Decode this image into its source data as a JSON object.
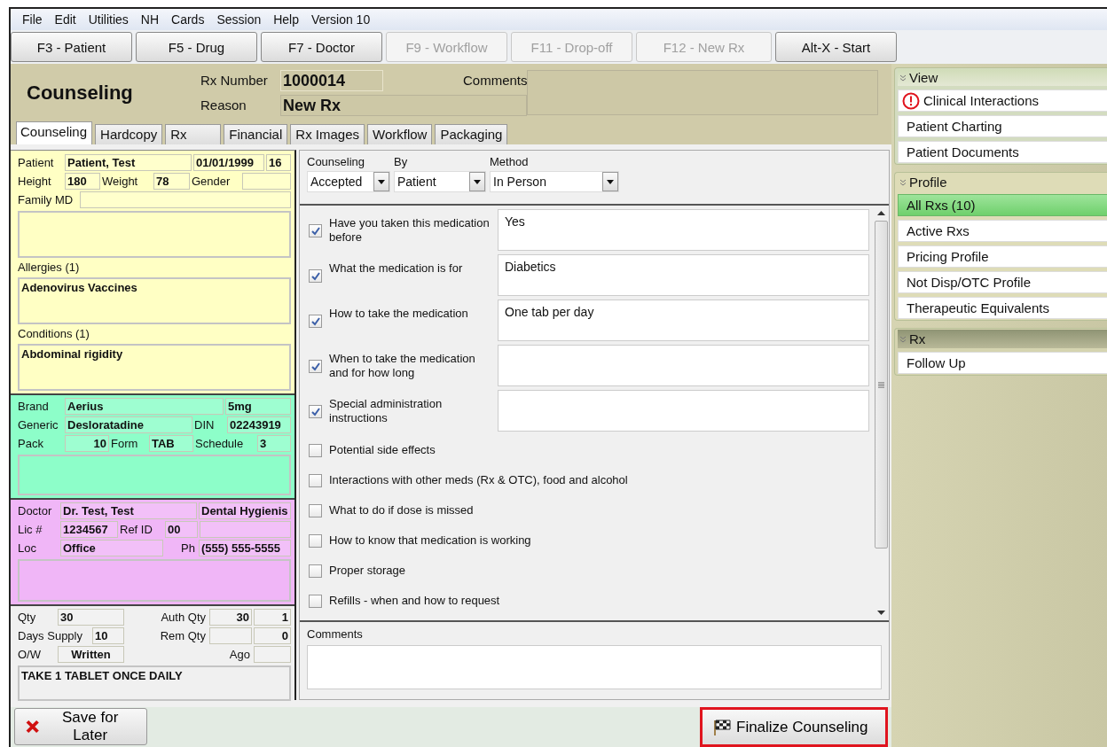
{
  "menu": [
    "File",
    "Edit",
    "Utilities",
    "NH",
    "Cards",
    "Session",
    "Help",
    "Version 10"
  ],
  "toolbar": [
    {
      "label": "F3 - Patient",
      "disabled": false
    },
    {
      "label": "F5 - Drug",
      "disabled": false
    },
    {
      "label": "F7 - Doctor",
      "disabled": false
    },
    {
      "label": "F9 - Workflow",
      "disabled": true
    },
    {
      "label": "F11 - Drop-off",
      "disabled": true
    },
    {
      "label": "F12 - New Rx",
      "disabled": true
    },
    {
      "label": "Alt-X - Start",
      "disabled": false
    }
  ],
  "header": {
    "title": "Counseling",
    "rx_number_label": "Rx Number",
    "rx_number": "1000014",
    "reason_label": "Reason",
    "reason": "New Rx",
    "comments_label": "Comments"
  },
  "tabs": [
    {
      "label": "Counseling",
      "selected": true
    },
    {
      "label": "Hardcopy",
      "selected": false
    },
    {
      "label": "Rx",
      "selected": false
    },
    {
      "label": "Financial",
      "selected": false
    },
    {
      "label": "Rx Images",
      "selected": false
    },
    {
      "label": "Workflow",
      "selected": false
    },
    {
      "label": "Packaging",
      "selected": false
    }
  ],
  "panels": [
    {
      "kind": "patient",
      "items": [
        {
          "kind": "row",
          "cells": [
            {
              "kind": "label",
              "text": "Patient"
            },
            {
              "kind": "value",
              "text": "Patient, Test"
            },
            {
              "kind": "value",
              "text": "01/01/1999"
            },
            {
              "kind": "value",
              "text": "16"
            }
          ]
        },
        {
          "kind": "row",
          "cells": [
            {
              "kind": "label",
              "text": "Height"
            },
            {
              "kind": "value",
              "text": "180"
            },
            {
              "kind": "label",
              "text": "Weight"
            },
            {
              "kind": "value",
              "text": "78"
            },
            {
              "kind": "label",
              "text": "Gender"
            },
            {
              "kind": "value"
            }
          ]
        },
        {
          "kind": "row",
          "cells": [
            {
              "kind": "label",
              "text": "Family MD"
            },
            {
              "kind": "value"
            }
          ]
        },
        {
          "kind": "note"
        },
        {
          "kind": "caption",
          "text": "Allergies (1)"
        },
        {
          "kind": "note",
          "text": "Adenovirus Vaccines"
        },
        {
          "kind": "caption",
          "text": "Conditions (1)"
        },
        {
          "kind": "note",
          "text": "Abdominal rigidity"
        }
      ]
    },
    {
      "kind": "drug",
      "items": [
        {
          "kind": "row",
          "cells": [
            {
              "kind": "label",
              "text": "Brand"
            },
            {
              "kind": "value",
              "text": "Aerius"
            },
            {
              "kind": "value",
              "text": "5mg"
            }
          ]
        },
        {
          "kind": "row",
          "cells": [
            {
              "kind": "label",
              "text": "Generic"
            },
            {
              "kind": "value",
              "text": "Desloratadine"
            },
            {
              "kind": "label",
              "text": "DIN"
            },
            {
              "kind": "value",
              "text": "02243919"
            }
          ]
        },
        {
          "kind": "row",
          "cells": [
            {
              "kind": "label",
              "text": "Pack"
            },
            {
              "kind": "number",
              "text": "10"
            },
            {
              "kind": "label",
              "text": "Form"
            },
            {
              "kind": "value",
              "text": "TAB"
            },
            {
              "kind": "label",
              "text": "Schedule"
            },
            {
              "kind": "value",
              "text": "3"
            }
          ]
        },
        {
          "kind": "note"
        }
      ]
    },
    {
      "kind": "doctor",
      "items": [
        {
          "kind": "row",
          "cells": [
            {
              "kind": "label",
              "text": "Doctor"
            },
            {
              "kind": "value",
              "text": "Dr. Test, Test"
            },
            {
              "kind": "value",
              "text": "Dental Hygienis"
            }
          ]
        },
        {
          "kind": "row",
          "cells": [
            {
              "kind": "label",
              "text": "Lic #"
            },
            {
              "kind": "value",
              "text": "1234567"
            },
            {
              "kind": "label",
              "text": "Ref ID"
            },
            {
              "kind": "value",
              "text": "00"
            },
            {
              "kind": "value"
            }
          ]
        },
        {
          "kind": "row",
          "cells": [
            {
              "kind": "label",
              "text": "Loc"
            },
            {
              "kind": "value",
              "text": "Office"
            },
            {
              "kind": "label_right",
              "text": "Ph"
            },
            {
              "kind": "value",
              "text": "(555) 555-5555"
            }
          ]
        },
        {
          "kind": "note"
        }
      ]
    },
    {
      "kind": "rx",
      "items": [
        {
          "kind": "row",
          "cells": [
            {
              "kind": "label",
              "text": "Qty"
            },
            {
              "kind": "value",
              "text": "30"
            },
            {
              "kind": "label_right",
              "text": "Auth Qty"
            },
            {
              "kind": "number",
              "text": "30"
            },
            {
              "kind": "number",
              "text": "1"
            }
          ]
        },
        {
          "kind": "row",
          "cells": [
            {
              "kind": "label",
              "text": "Days Supply"
            },
            {
              "kind": "value",
              "text": "10"
            },
            {
              "kind": "label_right",
              "text": "Rem Qty"
            },
            {
              "kind": "number"
            },
            {
              "kind": "number",
              "text": "0"
            }
          ]
        },
        {
          "kind": "row",
          "cells": [
            {
              "kind": "label",
              "text": "O/W"
            },
            {
              "kind": "centered",
              "text": "Written"
            },
            {
              "kind": "label_right",
              "text": "Ago"
            },
            {
              "kind": "value"
            }
          ]
        },
        {
          "kind": "note",
          "text": "TAKE 1 TABLET ONCE DAILY"
        }
      ]
    }
  ],
  "counseling": {
    "selects": [
      {
        "label": "Counseling",
        "value": "Accepted"
      },
      {
        "label": "By",
        "value": "Patient"
      },
      {
        "label": "Method",
        "value": "In Person"
      }
    ],
    "checklist": [
      {
        "kind": "with_note",
        "label": "Have you taken this medication before",
        "checked": true,
        "note": "Yes"
      },
      {
        "kind": "with_note",
        "label": "What the medication is for",
        "checked": true,
        "note": "Diabetics"
      },
      {
        "kind": "with_note",
        "label": "How to take the medication",
        "checked": true,
        "note": "One tab per day"
      },
      {
        "kind": "with_note",
        "label": "When to take the medication and for how long",
        "checked": true
      },
      {
        "kind": "with_note",
        "label": "Special administration instructions",
        "checked": true
      },
      {
        "kind": "plain",
        "label": "Potential side effects",
        "checked": false
      },
      {
        "kind": "plain",
        "label": "Interactions with other meds (Rx & OTC), food and alcohol",
        "checked": false
      },
      {
        "kind": "plain",
        "label": "What to do if dose is missed",
        "checked": false
      },
      {
        "kind": "plain",
        "label": "How to know that medication is working",
        "checked": false
      },
      {
        "kind": "plain",
        "label": "Proper storage",
        "checked": false
      },
      {
        "kind": "plain",
        "label": "Refills - when and how to request",
        "checked": false
      }
    ],
    "comments_label": "Comments"
  },
  "actions": [
    {
      "kind": "cancel",
      "label": "Save for Later",
      "highlighted": false
    },
    {
      "kind": "finalize",
      "label": "Finalize Counseling",
      "highlighted": true
    }
  ],
  "sidebar": [
    {
      "kind": "view",
      "title": "View",
      "items": [
        {
          "label": "Clinical Interactions",
          "alert": true,
          "selected": false
        },
        {
          "label": "Patient Charting",
          "alert": false,
          "selected": false
        },
        {
          "label": "Patient Documents",
          "alert": false,
          "selected": false
        }
      ]
    },
    {
      "kind": "profile",
      "title": "Profile",
      "items": [
        {
          "label": "All Rxs (10)",
          "alert": false,
          "selected": true
        },
        {
          "label": "Active Rxs",
          "alert": false,
          "selected": false
        },
        {
          "label": "Pricing Profile",
          "alert": false,
          "selected": false
        },
        {
          "label": "Not Disp/OTC Profile",
          "alert": false,
          "selected": false
        },
        {
          "label": "Therapeutic Equivalents",
          "alert": false,
          "selected": false
        }
      ]
    },
    {
      "kind": "rx",
      "title": "Rx",
      "items": [
        {
          "label": "Follow Up",
          "alert": false,
          "selected": false
        }
      ]
    }
  ]
}
